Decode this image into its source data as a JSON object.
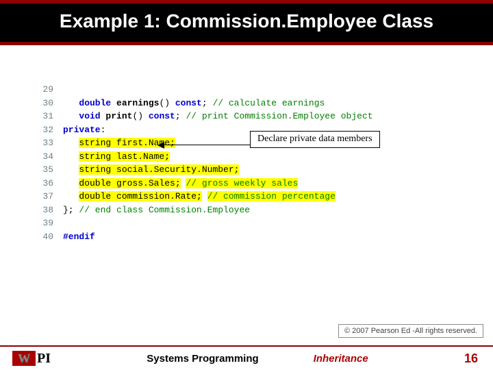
{
  "title": "Example 1: Commission.Employee Class",
  "callout": "Declare private data members",
  "copyright": "© 2007 Pearson Ed -All rights reserved.",
  "footer": {
    "left": "Systems Programming",
    "center": "Inheritance",
    "pagenum": "16"
  },
  "logo": {
    "w": "W",
    "pi": "PI"
  },
  "code": {
    "l29": {
      "n": "29"
    },
    "l30": {
      "n": "30",
      "kw": "double",
      "fn": " earnings",
      "rest": "() ",
      "kw2": "const",
      "rest2": "; ",
      "com": "// calculate earnings"
    },
    "l31": {
      "n": "31",
      "kw": "void",
      "fn": " print",
      "rest": "() ",
      "kw2": "const",
      "rest2": "; ",
      "com": "// print Commission.Employee object"
    },
    "l32": {
      "n": "32",
      "kw": "private",
      "rest": ":"
    },
    "l33": {
      "n": "33",
      "hl": "string first.Name;"
    },
    "l34": {
      "n": "34",
      "hl": "string last.Name;"
    },
    "l35": {
      "n": "35",
      "hl": "string social.Security.Number;"
    },
    "l36": {
      "n": "36",
      "hl": "double gross.Sales;",
      "sp": " ",
      "com": "// gross weekly sales"
    },
    "l37": {
      "n": "37",
      "hl": "double commission.Rate;",
      "sp": " ",
      "com": "// commission percentage"
    },
    "l38": {
      "n": "38",
      "rest": "}; ",
      "com": "// end class Commission.Employee"
    },
    "l39": {
      "n": "39"
    },
    "l40": {
      "n": "40",
      "kw": "#endif"
    }
  }
}
